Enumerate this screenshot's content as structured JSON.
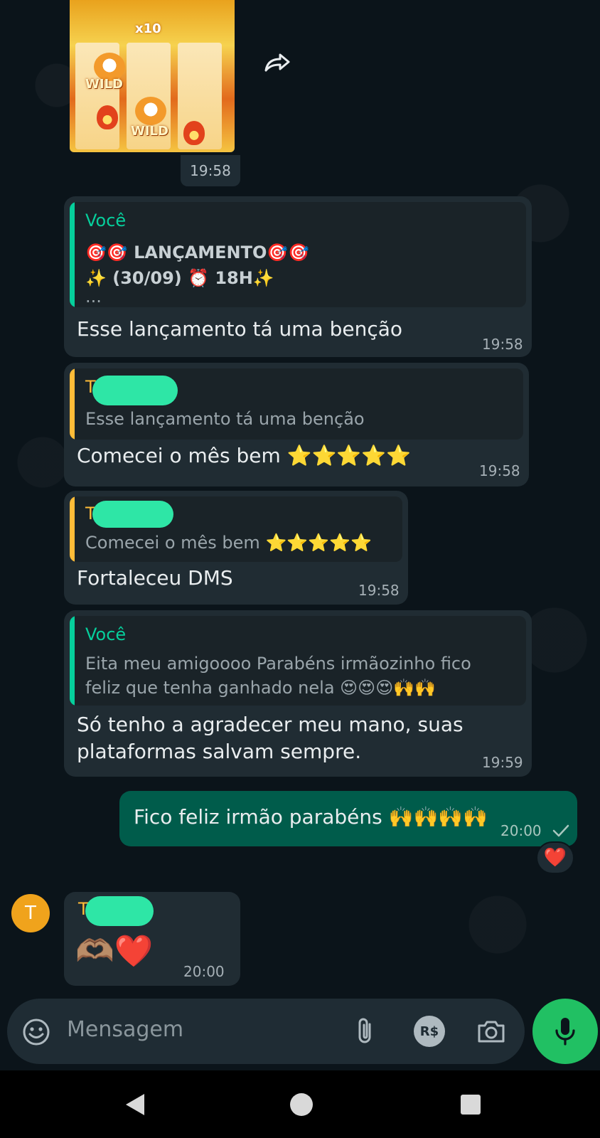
{
  "media_message": {
    "multiplier": "x10",
    "wild_label": "WILD",
    "time": "19:58"
  },
  "messages": [
    {
      "quote_name": "Você",
      "quote_line1": "🎯🎯 LANÇAMENTO🎯🎯",
      "quote_line2": "✨ (30/09)  ⏰ 18H✨",
      "quote_line3": "...",
      "text": "Esse lançamento tá uma benção",
      "time": "19:58"
    },
    {
      "quote_name": "Th",
      "quote_text": "Esse lançamento tá uma benção",
      "text": "Comecei o mês bem ⭐⭐⭐⭐⭐",
      "time": "19:58"
    },
    {
      "quote_name": "Th",
      "quote_text": "Comecei o mês bem ⭐⭐⭐⭐⭐",
      "text": "Fortaleceu DMS",
      "time": "19:58"
    },
    {
      "quote_name": "Você",
      "quote_line1": "Eita meu amigoooo Parabéns irmãozinho fico",
      "quote_line2": "feliz que tenha ganhado nela 😍😍😍🙌🙌",
      "text_line1": "Só tenho a agradecer meu mano, suas",
      "text_line2": "plataformas salvam sempre.",
      "time": "19:59"
    }
  ],
  "outgoing": {
    "text": "Fico feliz irmão parabéns 🙌🙌🙌🙌",
    "time": "20:00",
    "status_icon": "single-check-icon",
    "reaction": "❤️"
  },
  "last_incoming": {
    "avatar_letter": "T",
    "sender": "T",
    "text": "🫶🏽❤️",
    "time": "20:00"
  },
  "composer": {
    "placeholder": "Mensagem",
    "currency_label": "R$",
    "icons": [
      "emoji-icon",
      "attach-icon",
      "payment-icon",
      "camera-icon",
      "mic-icon"
    ]
  },
  "colors": {
    "background": "#0b141a",
    "incoming_bubble": "#202c33",
    "outgoing_bubble": "#005c4b",
    "quote_self": "#06cf9c",
    "quote_other": "#ffbc38",
    "mic_button": "#21c063"
  }
}
